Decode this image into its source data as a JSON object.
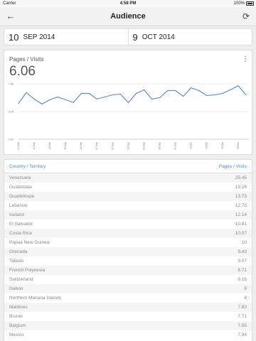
{
  "status_bar": {
    "carrier": "Carrier",
    "time": "4:58 PM",
    "battery": "100%"
  },
  "app_bar": {
    "title": "Audience",
    "back_icon": "arrow-left-icon",
    "refresh_icon": "refresh-icon"
  },
  "date_range": {
    "start": {
      "day": "10",
      "month_year": "SEP 2014"
    },
    "end": {
      "day": "9",
      "month_year": "OCT 2014"
    }
  },
  "metric": {
    "name": "Pages / Visits",
    "value": "6.06",
    "menu_icon": "more-vertical-icon"
  },
  "chart_data": {
    "type": "line",
    "color": "#4a86e8",
    "yticks": [
      "7.86",
      "3.76",
      "0.00"
    ],
    "ylim": [
      0,
      7.86
    ],
    "xticks": [
      "10 Sep",
      "12 Sep",
      "14 Sep",
      "16 Sep",
      "18 Sep",
      "20 Sep",
      "22 Sep",
      "24 Sep",
      "26 Sep",
      "28 Sep",
      "30 Sep",
      "02 Oct",
      "04 Oct",
      "06 Oct",
      "08 Oct"
    ],
    "x": [
      "10 Sep",
      "11 Sep",
      "12 Sep",
      "13 Sep",
      "14 Sep",
      "15 Sep",
      "16 Sep",
      "17 Sep",
      "18 Sep",
      "19 Sep",
      "20 Sep",
      "21 Sep",
      "22 Sep",
      "23 Sep",
      "24 Sep",
      "25 Sep",
      "26 Sep",
      "27 Sep",
      "28 Sep",
      "29 Sep",
      "30 Sep",
      "01 Oct",
      "02 Oct",
      "03 Oct",
      "04 Oct",
      "05 Oct",
      "06 Oct",
      "07 Oct",
      "08 Oct",
      "09 Oct"
    ],
    "values": [
      5.1,
      6.6,
      5.7,
      5.0,
      5.6,
      6.0,
      5.6,
      5.2,
      6.5,
      6.5,
      5.7,
      6.0,
      6.3,
      6.4,
      5.2,
      6.5,
      7.0,
      5.7,
      5.9,
      6.9,
      6.9,
      6.1,
      7.3,
      6.9,
      6.2,
      6.3,
      6.5,
      7.0,
      7.6,
      6.3
    ]
  },
  "table": {
    "col_country": "Country / Territory",
    "col_value": "Pages / Visits",
    "rows": [
      {
        "country": "Venezuela",
        "value": "25.45"
      },
      {
        "country": "Guatemala",
        "value": "19.26"
      },
      {
        "country": "Guadeloupe",
        "value": "13.73"
      },
      {
        "country": "Lebanon",
        "value": "12.75"
      },
      {
        "country": "Iceland",
        "value": "12.14"
      },
      {
        "country": "El Salvador",
        "value": "10.81"
      },
      {
        "country": "Costa Rica",
        "value": "10.07"
      },
      {
        "country": "Papua New Guinea",
        "value": "10"
      },
      {
        "country": "Grenada",
        "value": "9.43"
      },
      {
        "country": "Taiwan",
        "value": "9.07"
      },
      {
        "country": "French Polynesia",
        "value": "8.71"
      },
      {
        "country": "Switzerland",
        "value": "8.16"
      },
      {
        "country": "Gabon",
        "value": "8"
      },
      {
        "country": "Northern Mariana Islands",
        "value": "8"
      },
      {
        "country": "Maldives",
        "value": "7.83"
      },
      {
        "country": "Brunei",
        "value": "7.71"
      },
      {
        "country": "Belgium",
        "value": "7.55"
      },
      {
        "country": "Mexico",
        "value": "7.34"
      }
    ]
  }
}
